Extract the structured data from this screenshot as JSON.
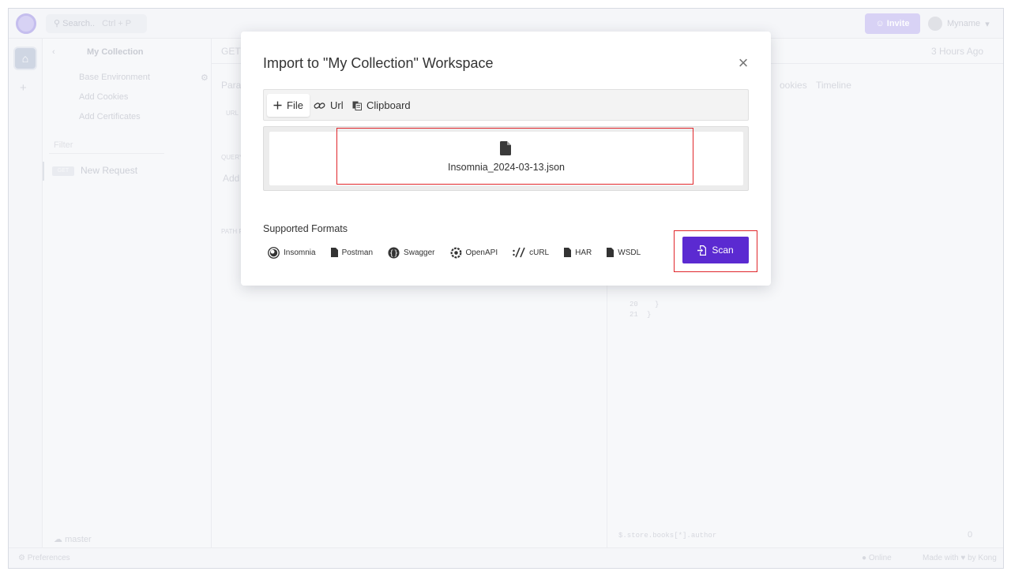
{
  "topbar": {
    "search_placeholder": "Search..",
    "search_shortcut": "Ctrl + P",
    "invite_label": "Invite",
    "username": "Myname"
  },
  "sidebar": {
    "collection_title": "My Collection",
    "environment": "Base Environment",
    "add_cookies": "Add Cookies",
    "add_certificates": "Add Certificates",
    "filter_placeholder": "Filter",
    "request_method": "GET",
    "request_name": "New Request",
    "branch": "master"
  },
  "request_pane": {
    "method": "GET",
    "params_tab": "Para",
    "url_label": "URL",
    "query_label": "QUERY",
    "add_label": "Add",
    "path_label": "PATH P"
  },
  "response_pane": {
    "time_ago": "3 Hours Ago",
    "cookies_tab": "ookies",
    "timeline_tab": "Timeline",
    "line_20": "20",
    "line_21": "21",
    "brace_20": "}",
    "brace_21": "}",
    "filter_query": "$.store.books[*].author",
    "count": "0"
  },
  "statusbar": {
    "preferences": "Preferences",
    "online": "Online",
    "made_with": "Made with ♥ by Kong"
  },
  "modal": {
    "title": "Import to \"My Collection\" Workspace",
    "close_glyph": "×",
    "tabs": [
      {
        "label": "File",
        "icon": "plus-icon",
        "active": true
      },
      {
        "label": "Url",
        "icon": "link-icon",
        "active": false
      },
      {
        "label": "Clipboard",
        "icon": "clipboard-icon",
        "active": false
      }
    ],
    "selected_file": "Insomnia_2024-03-13.json",
    "supported_formats_label": "Supported Formats",
    "formats": [
      {
        "label": "Insomnia",
        "icon": "insomnia-icon"
      },
      {
        "label": "Postman",
        "icon": "file-icon"
      },
      {
        "label": "Swagger",
        "icon": "swagger-icon"
      },
      {
        "label": "OpenAPI",
        "icon": "openapi-icon"
      },
      {
        "label": "cURL",
        "icon": "curl-icon"
      },
      {
        "label": "HAR",
        "icon": "file-icon"
      },
      {
        "label": "WSDL",
        "icon": "file-icon"
      }
    ],
    "scan_label": "Scan"
  },
  "colors": {
    "accent": "#5b2ad1",
    "highlight": "#e0262b"
  }
}
